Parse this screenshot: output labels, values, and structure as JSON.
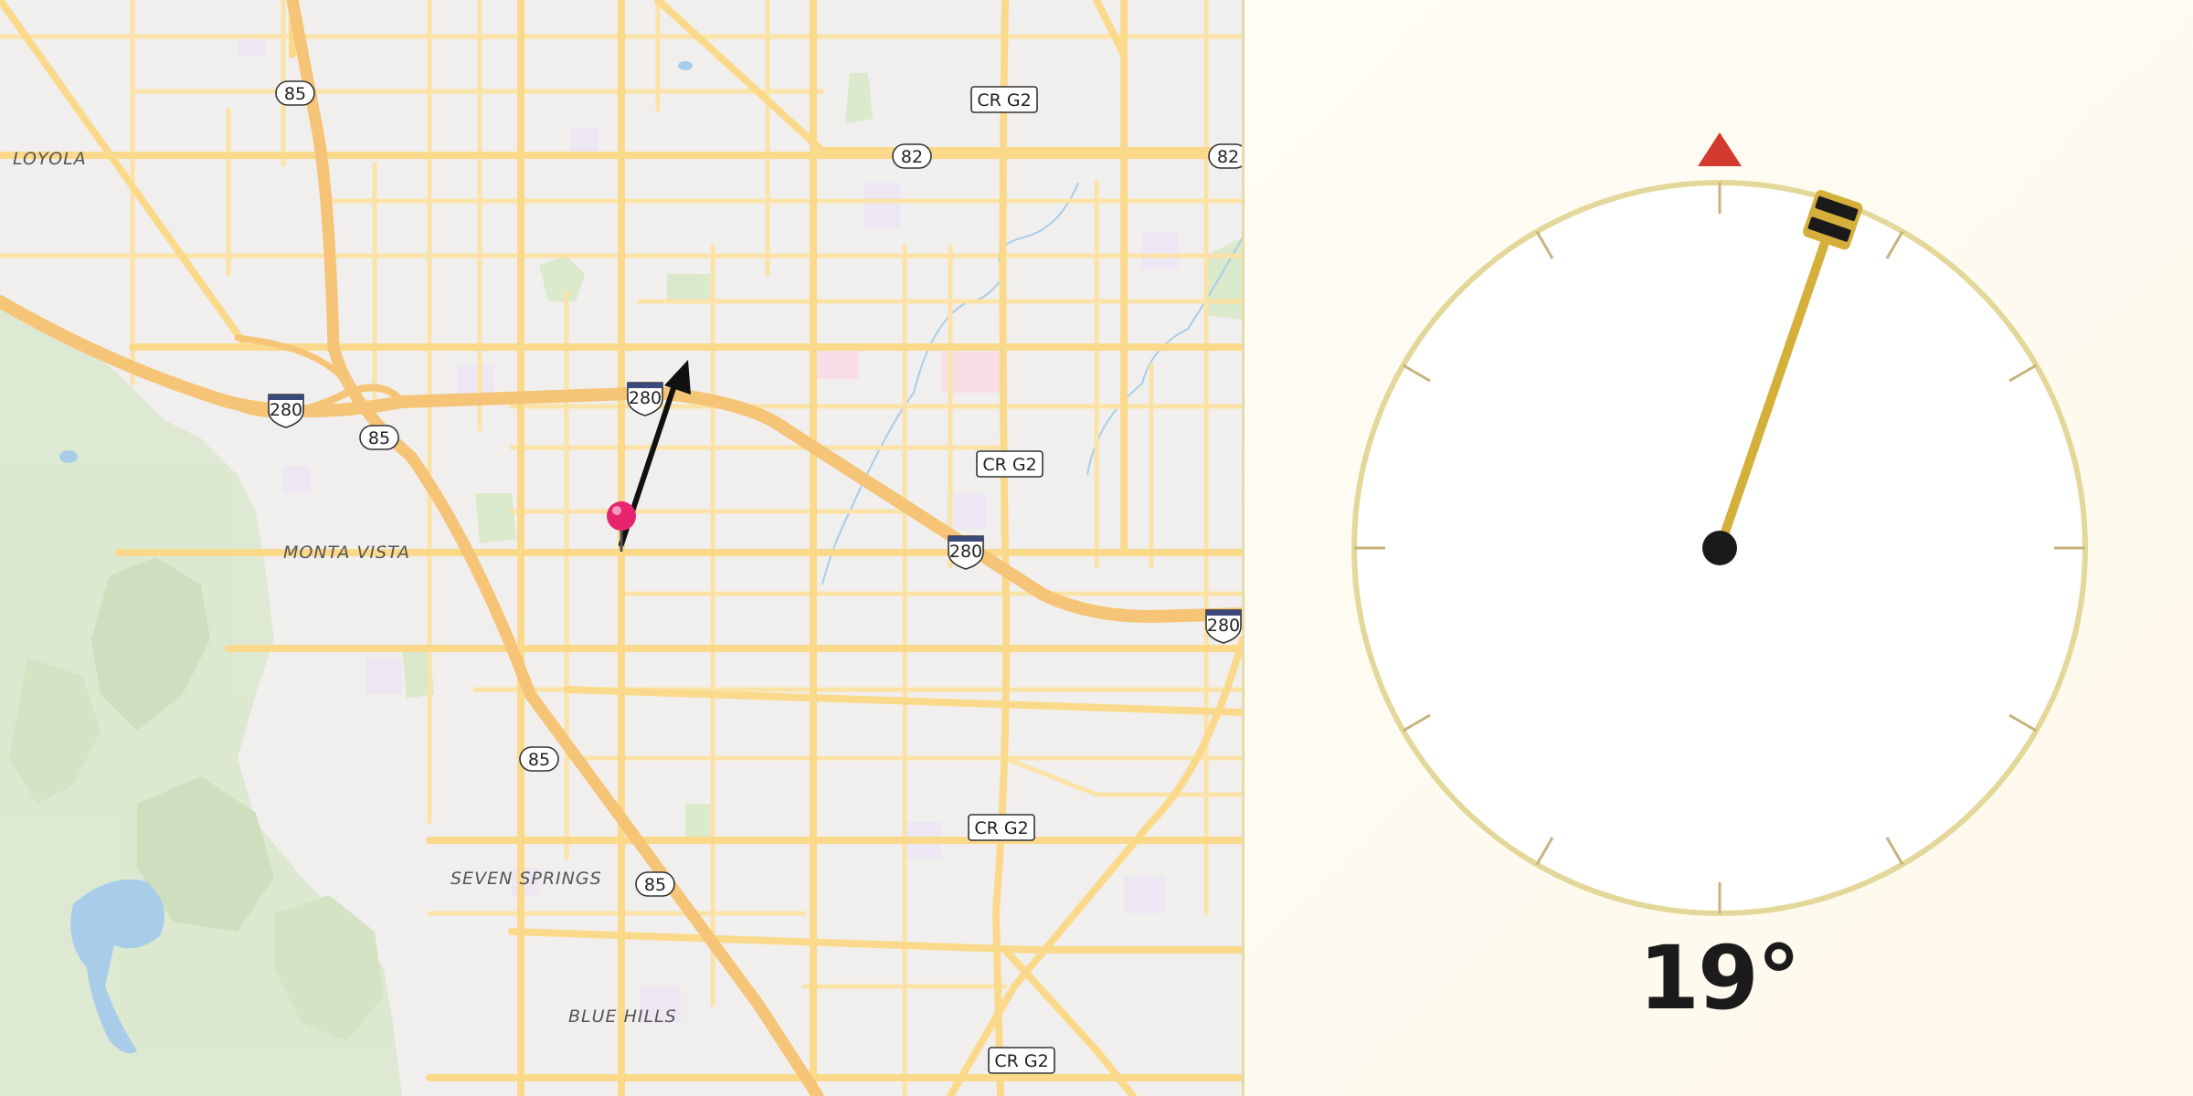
{
  "map": {
    "place_labels": [
      "LOYOLA",
      "MONTA VISTA",
      "SEVEN SPRINGS",
      "BLUE HILLS"
    ],
    "route_shields": {
      "interstate": "280",
      "state": [
        "85",
        "82"
      ],
      "county": "CR G2"
    },
    "pin_color": "#e8246e",
    "arrow_color": "#111111"
  },
  "compass": {
    "heading_deg": 19,
    "heading_label": "19°",
    "north_marker_color": "#d23a2e",
    "needle_color": "#d4b03b",
    "ring_color": "#e4d79a"
  }
}
